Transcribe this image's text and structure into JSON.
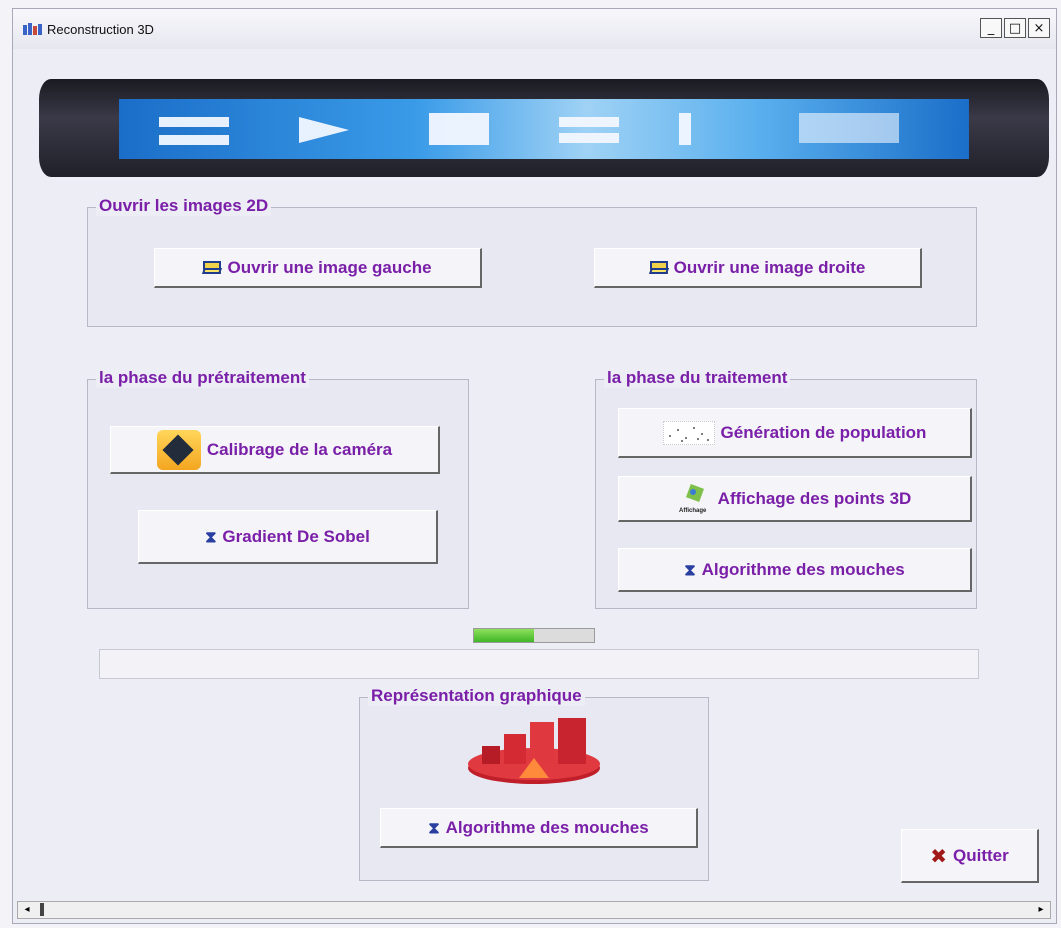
{
  "window": {
    "title": "Reconstruction 3D",
    "controls": [
      "_",
      "□",
      "×"
    ]
  },
  "banner": {
    "alt": "2D 3D"
  },
  "open_group": {
    "legend": "Ouvrir les images 2D",
    "left_button": "Ouvrir une image gauche",
    "right_button": "Ouvrir une image droite"
  },
  "preprocess_group": {
    "legend": "la phase du prétraitement",
    "calibration_button": "Calibrage de la caméra",
    "sobel_button": "Gradient De Sobel"
  },
  "process_group": {
    "legend": "la phase du traitement",
    "population_button": "Génération de population",
    "display_button": "Affichage des points 3D",
    "display_icon_caption": "Affichage",
    "flies_button": "Algorithme des mouches"
  },
  "progress": {
    "fraction": 0.5,
    "color": "#4cc233"
  },
  "graph_group": {
    "legend": "Représentation graphique",
    "flies_button": "Algorithme des mouches"
  },
  "quit_button": {
    "label": "Quitter",
    "icon": "x-icon",
    "icon_color": "#a01818"
  },
  "colors": {
    "accent": "#7a1fa8",
    "window_bg": "#ededf6"
  }
}
